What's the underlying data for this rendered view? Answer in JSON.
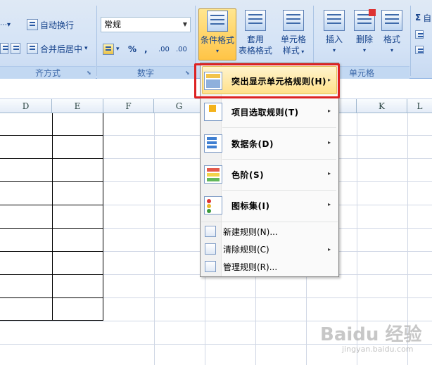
{
  "ribbon": {
    "alignment": {
      "wrap_text": "自动换行",
      "merge_center": "合并后居中",
      "merge_arrow": "▾",
      "group_label": "齐方式"
    },
    "number": {
      "format_value": "常规",
      "percent": "%",
      "comma": ",",
      "inc_decimal": ".00",
      "dec_decimal": ".00",
      "group_label": "数字"
    },
    "styles": {
      "conditional_format": "条件格式",
      "format_as_table_l1": "套用",
      "format_as_table_l2": "表格格式",
      "cell_style_l1": "单元格",
      "cell_style_l2": "样式"
    },
    "cells": {
      "insert": "插入",
      "delete": "删除",
      "format": "格式",
      "group_label": "单元格"
    },
    "editing": {
      "sum_symbol": "Σ",
      "sum_text": "自"
    }
  },
  "sheet": {
    "columns": [
      "D",
      "E",
      "F",
      "G",
      "K",
      "L"
    ]
  },
  "menu": {
    "items_big": [
      {
        "label": "突出显示单元格规则(H)",
        "icon": "highlight-rules-icon"
      },
      {
        "label": "项目选取规则(T)",
        "icon": "top-bottom-rules-icon"
      },
      {
        "label": "数据条(D)",
        "icon": "data-bars-icon"
      },
      {
        "label": "色阶(S)",
        "icon": "color-scales-icon"
      },
      {
        "label": "图标集(I)",
        "icon": "icon-sets-icon"
      }
    ],
    "items_small": [
      {
        "label": "新建规则(N)...",
        "icon": "new-rule-icon"
      },
      {
        "label": "清除规则(C)",
        "icon": "clear-rules-icon"
      },
      {
        "label": "管理规则(R)...",
        "icon": "manage-rules-icon"
      }
    ],
    "submenu_arrow": "▸"
  },
  "watermark": {
    "brand": "Baidu 经验",
    "url": "jingyan.baidu.com"
  },
  "colors": {
    "highlight_border": "#dd2222",
    "ribbon_text": "#15428b"
  }
}
